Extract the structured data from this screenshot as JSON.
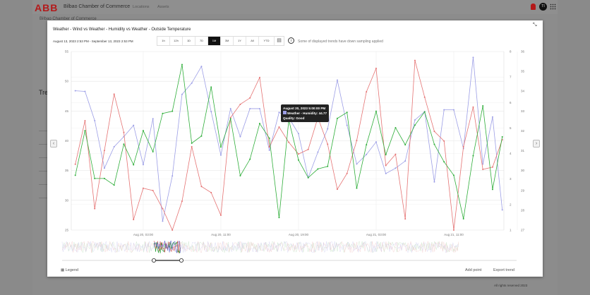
{
  "header": {
    "logo": "ABB",
    "site": "Bilbao Chamber of Commerce",
    "nav": [
      "Locations",
      "Assets"
    ],
    "avatar": "TI"
  },
  "page": {
    "breadcrumb": "Bilbao Chamber of Commerce",
    "heading": "Trends",
    "footer": "All rights reserved 2023"
  },
  "modal": {
    "title": "Weather - Wind vs Weather - Humidity vs Weather - Outside Temperature",
    "range": "August 13, 2023 2:53 PM - September 13, 2023 2:53 PM",
    "ranges": [
      "1h",
      "12h",
      "1D",
      "7D",
      "1M",
      "3M",
      "1Y",
      "All",
      "YTD"
    ],
    "selected_range": "1M",
    "info": "Some of displayed trends have down sampling applied",
    "legend": "Legend",
    "add_point": "Add point",
    "export": "Export trend",
    "tooltip": {
      "time": "August 20, 2023 5:00:00 PM",
      "series": "Weather - Humidity: 44.77",
      "quality": "Quality: Good"
    }
  },
  "chart_data": {
    "type": "line",
    "x_start": "Aug 19, 20:00",
    "x_step": "1 hour",
    "x_ticks": [
      "Aug 20, 03:00",
      "Aug 20, 11:00",
      "Aug 20, 19:00",
      "Aug 21, 03:00",
      "Aug 21, 11:00"
    ],
    "axes": [
      {
        "id": "y1",
        "range": [
          25,
          55
        ],
        "ticks": [
          25,
          30,
          35,
          40,
          45,
          50,
          55
        ]
      },
      {
        "id": "y2",
        "range": [
          1,
          8
        ],
        "ticks": [
          1,
          2,
          3,
          4,
          5,
          6,
          7,
          8
        ]
      },
      {
        "id": "y3",
        "range": [
          27,
          36
        ],
        "ticks": [
          27,
          28,
          29,
          30,
          31,
          32,
          33,
          34,
          35,
          36
        ]
      }
    ],
    "grid": true,
    "series": [
      {
        "axis": "y1",
        "color": "#9c9ee6",
        "values": [
          48.4,
          48.3,
          43.4,
          35.4,
          39.0,
          40.7,
          42.6,
          36.0,
          43.7,
          26.5,
          34.1,
          47.8,
          49.7,
          52.5,
          44.9,
          37.6,
          45.4,
          40.7,
          45.4,
          45.4,
          38.4,
          44.77,
          43.9,
          41.2,
          33.8,
          38.1,
          42.0,
          50.2,
          42.6,
          36.1,
          37.7,
          39.8,
          34.5,
          35.4,
          36.6,
          43.5,
          44.9,
          33.1,
          45.2,
          45.2,
          38.7,
          54.0,
          36.1,
          44.0,
          28.4
        ]
      },
      {
        "axis": "y2",
        "color": "#e57373",
        "values": [
          3.58,
          5.29,
          1.84,
          4.12,
          6.33,
          4.83,
          1.41,
          2.64,
          2.55,
          1.84,
          1.0,
          2.13,
          4.27,
          2.71,
          2.47,
          1.58,
          5.41,
          5.93,
          6.18,
          6.98,
          4.26,
          5.04,
          4.44,
          3.98,
          4.16,
          5.41,
          4.37,
          2.6,
          3.22,
          4.51,
          6.42,
          7.34,
          3.53,
          3.97,
          1.44,
          7.65,
          6.21,
          4.87,
          4.49,
          1.0,
          4.27,
          5.82,
          3.38,
          3.47,
          4.55
        ]
      },
      {
        "axis": "y3",
        "color": "#2fae3a",
        "values": [
          29.76,
          32.01,
          29.6,
          29.6,
          29.27,
          31.33,
          30.29,
          32.01,
          30.95,
          32.88,
          32.99,
          35.34,
          31.38,
          31.74,
          34.21,
          31.19,
          32.61,
          29.74,
          30.57,
          32.37,
          31.63,
          27.63,
          32.55,
          30.53,
          29.64,
          30.08,
          30.21,
          32.63,
          32.93,
          29.11,
          31.3,
          32.99,
          30.8,
          32.16,
          31.3,
          32.29,
          32.96,
          31.32,
          30.44,
          29.76,
          27.57,
          30.75,
          33.26,
          29.05,
          31.7
        ]
      }
    ]
  }
}
